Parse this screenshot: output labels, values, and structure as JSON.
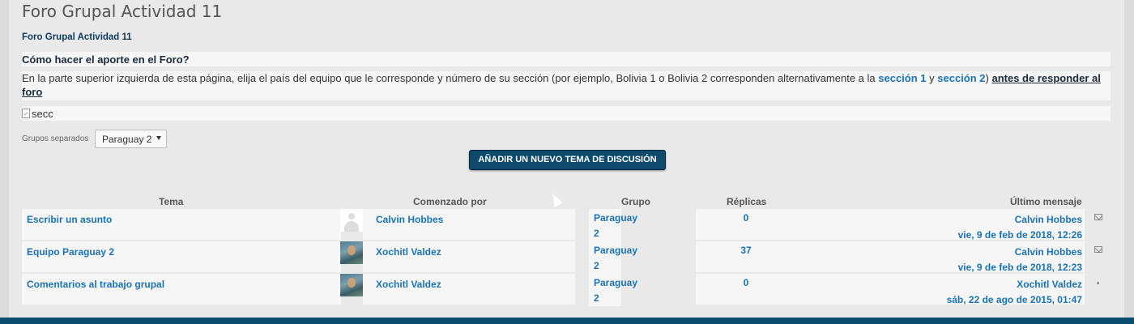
{
  "page": {
    "title": "Foro Grupal Actividad 11",
    "subtitle": "Foro Grupal Actividad 11",
    "how_heading": "Cómo hacer el aporte en el Foro?",
    "intro_text": "En la parte superior izquierda de esta página, elija el país del equipo que le corresponde y número de su sección (por ejemplo, Bolivia 1 o Bolivia 2 corresponden alternativamente a la ",
    "section1_link": "sección 1",
    "and_word": " y ",
    "section2_link": "sección 2",
    "close_paren": ")",
    "before_reply_link": "antes de responder al foro",
    "broken_image_alt": "secc"
  },
  "groups": {
    "label": "Grupos separados",
    "selected": "Paraguay 2"
  },
  "actions": {
    "add_topic": "AÑADIR UN NUEVO TEMA DE DISCUSIÓN"
  },
  "table": {
    "headers": {
      "topic": "Tema",
      "started_by": "Comenzado por",
      "group": "Grupo",
      "replies": "Réplicas",
      "last_post": "Último mensaje"
    },
    "rows": [
      {
        "topic": "Escribir un asunto",
        "author": "Calvin Hobbes",
        "group_line1": "Paraguay",
        "group_line2": "2",
        "replies": "0",
        "last_author": "Calvin Hobbes",
        "last_date": "vie, 9 de feb de 2018, 12:26"
      },
      {
        "topic": "Equipo Paraguay 2",
        "author": "Xochitl Valdez",
        "group_line1": "Paraguay",
        "group_line2": "2",
        "replies": "37",
        "last_author": "Calvin Hobbes",
        "last_date": "vie, 9 de feb de 2018, 12:23"
      },
      {
        "topic": "Comentarios al trabajo grupal",
        "author": "Xochitl Valdez",
        "group_line1": "Paraguay",
        "group_line2": "2",
        "replies": "0",
        "last_author": "Xochitl Valdez",
        "last_date": "sáb, 22 de ago de 2015, 01:47"
      }
    ]
  },
  "colors": {
    "accent": "#0d4a6b",
    "link": "#1a73b8"
  }
}
